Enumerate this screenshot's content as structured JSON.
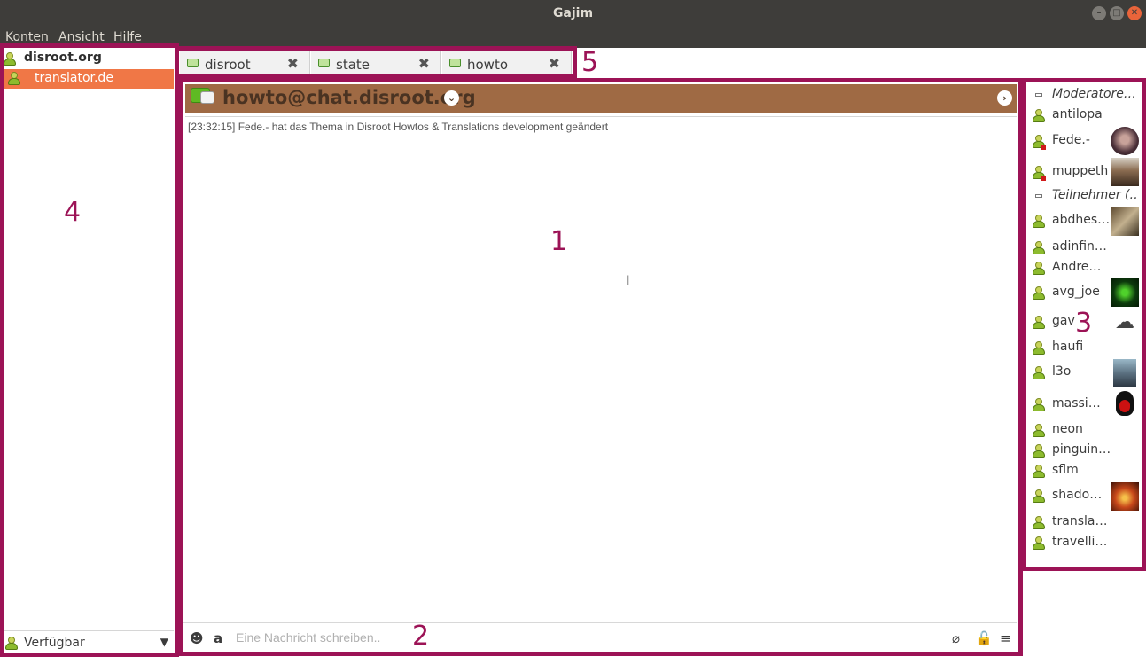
{
  "window": {
    "title": "Gajim"
  },
  "menubar": [
    "Konten",
    "Ansicht",
    "Hilfe"
  ],
  "roster": {
    "account": "disroot.org",
    "contacts": [
      {
        "label": "translator.de",
        "selected": true
      }
    ],
    "status": "Verfügbar"
  },
  "tabs": [
    {
      "label": "disroot",
      "active": false
    },
    {
      "label": "state",
      "active": false
    },
    {
      "label": "howto",
      "active": true
    }
  ],
  "chat": {
    "room_jid": "howto@chat.disroot.org",
    "log": [
      "[23:32:15] Fede.- hat das Thema in Disroot Howtos & Translations development geändert"
    ],
    "input_placeholder": "Eine Nachricht schreiben.."
  },
  "occupants": {
    "groups": [
      {
        "label": "Moderatore…",
        "members": [
          {
            "nick": "antilopa",
            "avatar": null
          },
          {
            "nick": "Fede.-",
            "avatar": "photo",
            "dnd": true
          },
          {
            "nick": "muppeth",
            "avatar": "photo",
            "dnd": true
          }
        ]
      },
      {
        "label": "Teilnehmer (…",
        "members": [
          {
            "nick": "abdhes…",
            "avatar": "photo"
          },
          {
            "nick": "adinfin…",
            "avatar": null
          },
          {
            "nick": "Andre…",
            "avatar": null
          },
          {
            "nick": "avg_joe",
            "avatar": "green"
          },
          {
            "nick": "gav",
            "avatar": "cloud"
          },
          {
            "nick": "haufi",
            "avatar": null
          },
          {
            "nick": "l3o",
            "avatar": "photo"
          },
          {
            "nick": "massi…",
            "avatar": "penguin"
          },
          {
            "nick": "neon",
            "avatar": null
          },
          {
            "nick": "pinguin…",
            "avatar": null
          },
          {
            "nick": "sflm",
            "avatar": null
          },
          {
            "nick": "shado…",
            "avatar": "fire"
          },
          {
            "nick": "transla…",
            "avatar": null
          },
          {
            "nick": "travelli…",
            "avatar": null
          }
        ]
      }
    ]
  },
  "annotations": [
    "1",
    "2",
    "3",
    "4",
    "5"
  ],
  "colors": {
    "annotation": "#9c1356",
    "header": "#9f6a44",
    "selection": "#f07746",
    "titlebar": "#3e3d3a"
  }
}
